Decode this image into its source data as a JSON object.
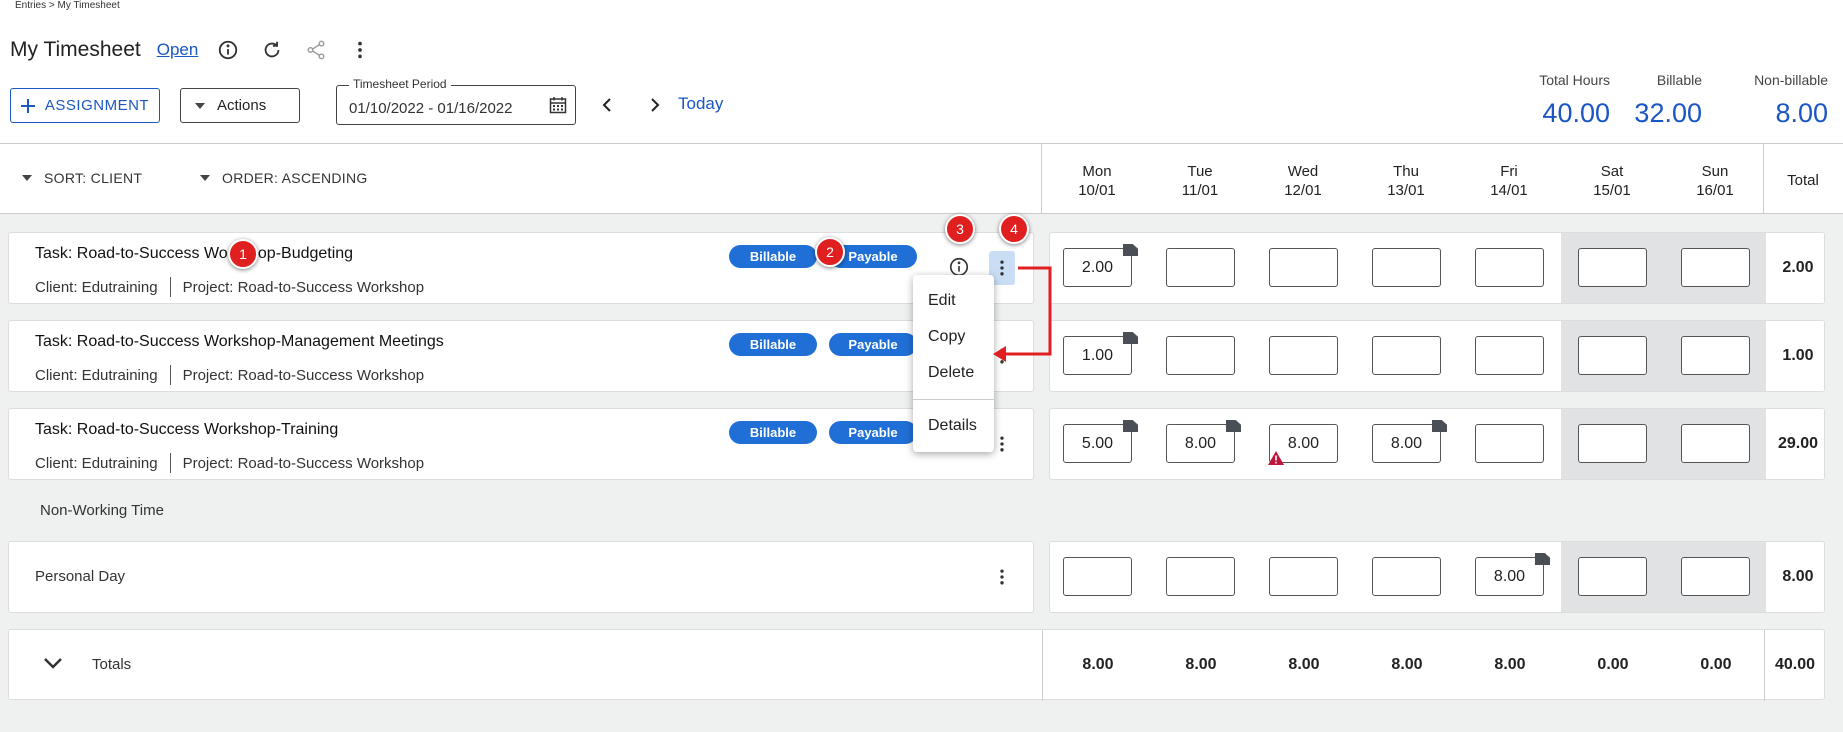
{
  "breadcrumb": "Entries > My Timesheet",
  "header": {
    "title": "My Timesheet",
    "status": "Open"
  },
  "toolbar": {
    "assign_label": "ASSIGNMENT",
    "actions_label": "Actions",
    "period_label": "Timesheet Period",
    "period_value": "01/10/2022 - 01/16/2022",
    "today_label": "Today"
  },
  "summary": {
    "total_label": "Total Hours",
    "total_value": "40.00",
    "billable_label": "Billable",
    "billable_value": "32.00",
    "nonbillable_label": "Non-billable",
    "nonbillable_value": "8.00"
  },
  "sort": {
    "sort_label": "SORT: CLIENT",
    "order_label": "ORDER: ASCENDING"
  },
  "days": [
    {
      "name": "Mon",
      "date": "10/01"
    },
    {
      "name": "Tue",
      "date": "11/01"
    },
    {
      "name": "Wed",
      "date": "12/01"
    },
    {
      "name": "Thu",
      "date": "13/01"
    },
    {
      "name": "Fri",
      "date": "14/01"
    },
    {
      "name": "Sat",
      "date": "15/01"
    },
    {
      "name": "Sun",
      "date": "16/01"
    }
  ],
  "total_header": "Total",
  "rows": [
    {
      "title": "Task: Road-to-Success Workshop-Budgeting",
      "client": "Client: Edutraining",
      "project": "Project: Road-to-Success Workshop",
      "billable": "Billable",
      "payable": "Payable",
      "cells": [
        "2.00",
        "",
        "",
        "",
        "",
        "",
        ""
      ],
      "total": "2.00"
    },
    {
      "title": "Task: Road-to-Success Workshop-Management Meetings",
      "client": "Client: Edutraining",
      "project": "Project: Road-to-Success Workshop",
      "billable": "Billable",
      "payable": "Payable",
      "cells": [
        "1.00",
        "",
        "",
        "",
        "",
        "",
        ""
      ],
      "total": "1.00"
    },
    {
      "title": "Task: Road-to-Success Workshop-Training",
      "client": "Client: Edutraining",
      "project": "Project: Road-to-Success Workshop",
      "billable": "Billable",
      "payable": "Payable",
      "cells": [
        "5.00",
        "8.00",
        "8.00",
        "8.00",
        "",
        "",
        ""
      ],
      "total": "29.00"
    }
  ],
  "non_working_label": "Non-Working Time",
  "personal": {
    "title": "Personal Day",
    "cells": [
      "",
      "",
      "",
      "",
      "8.00",
      "",
      ""
    ],
    "total": "8.00"
  },
  "totals": {
    "label": "Totals",
    "values": [
      "8.00",
      "8.00",
      "8.00",
      "8.00",
      "8.00",
      "0.00",
      "0.00"
    ],
    "total": "40.00"
  },
  "menu": {
    "edit": "Edit",
    "copy": "Copy",
    "delete": "Delete",
    "details": "Details"
  },
  "callouts": [
    "1",
    "2",
    "3",
    "4"
  ],
  "colors": {
    "accent": "#1a56c4",
    "pill": "#1f6fd6",
    "callout": "#e02020",
    "warning": "#c0143c"
  }
}
